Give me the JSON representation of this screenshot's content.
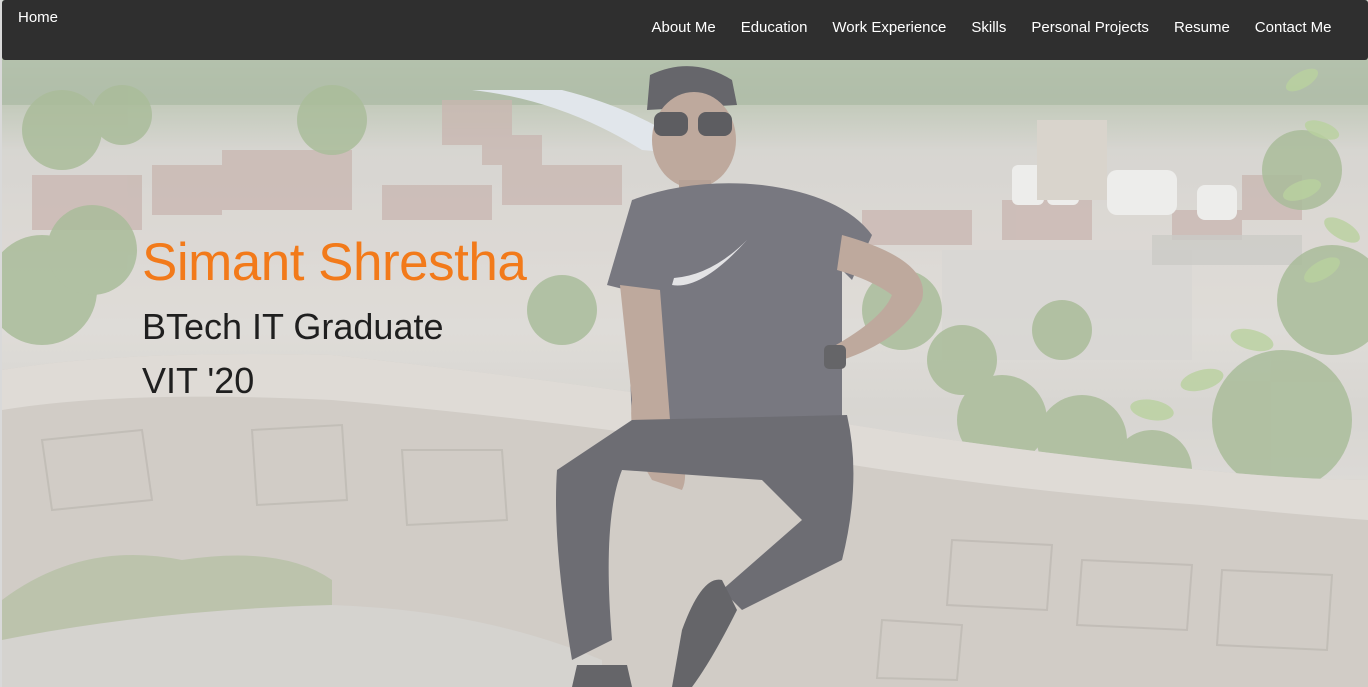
{
  "navbar": {
    "brand": "Home",
    "links": [
      {
        "label": "About Me"
      },
      {
        "label": "Education"
      },
      {
        "label": "Work Experience"
      },
      {
        "label": "Skills"
      },
      {
        "label": "Personal Projects"
      },
      {
        "label": "Resume"
      },
      {
        "label": "Contact Me"
      }
    ]
  },
  "hero": {
    "name": "Simant Shrestha",
    "line1": "BTech IT Graduate",
    "line2": "VIT '20"
  },
  "colors": {
    "navbar_bg": "#2f2f2f",
    "nav_text": "#ffffff",
    "name_accent": "#f27a1a",
    "subtitle_text": "#1f1f1f"
  }
}
